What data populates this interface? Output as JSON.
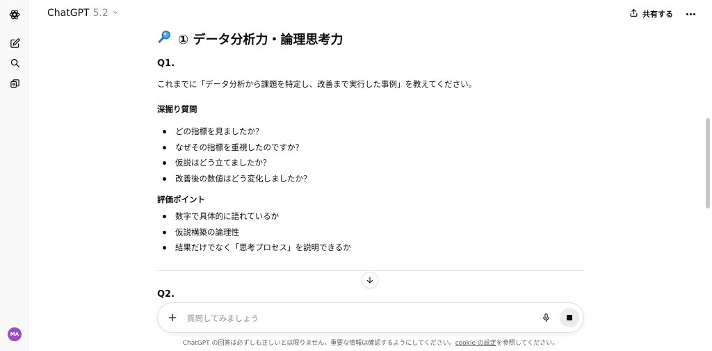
{
  "app": {
    "model_name": "ChatGPT",
    "model_version": "5.2",
    "share_label": "共有する",
    "avatar_initials": "MA"
  },
  "content": {
    "section_title": "① データ分析力・論理思考力",
    "q1": {
      "label": "Q1.",
      "text": "これまでに「データ分析から課題を特定し、改善まで実行した事例」を教えてください。",
      "deep_dive_heading": "深掘り質問",
      "deep_dive_items": [
        "どの指標を見ましたか？",
        "なぜその指標を重視したのですか？",
        "仮説はどう立てましたか？",
        "改善後の数値はどう変化しましたか？"
      ],
      "eval_heading": "評価ポイント",
      "eval_items": [
        "数字で具体的に語れているか",
        "仮説構築の論理性",
        "結果だけでなく「思考プロセス」を説明できるか"
      ]
    },
    "q2": {
      "label": "Q2."
    }
  },
  "composer": {
    "placeholder": "質問してみましょう"
  },
  "footer": {
    "before_link": "ChatGPT の回答は必ずしも正しいとは限りません。重要な情報は確認するようにしてください。",
    "link_text": "cookie の設定",
    "after_link": "を参照してください。"
  },
  "colors": {
    "avatar_bg": "#9b4fc0",
    "text": "#0d0d0d",
    "muted": "#8f8f8f"
  },
  "icons": {
    "logo": "openai-logo-icon",
    "new_chat": "new-chat-icon",
    "search": "search-icon",
    "library": "library-icon",
    "section_emoji": "magnifier-icon"
  }
}
